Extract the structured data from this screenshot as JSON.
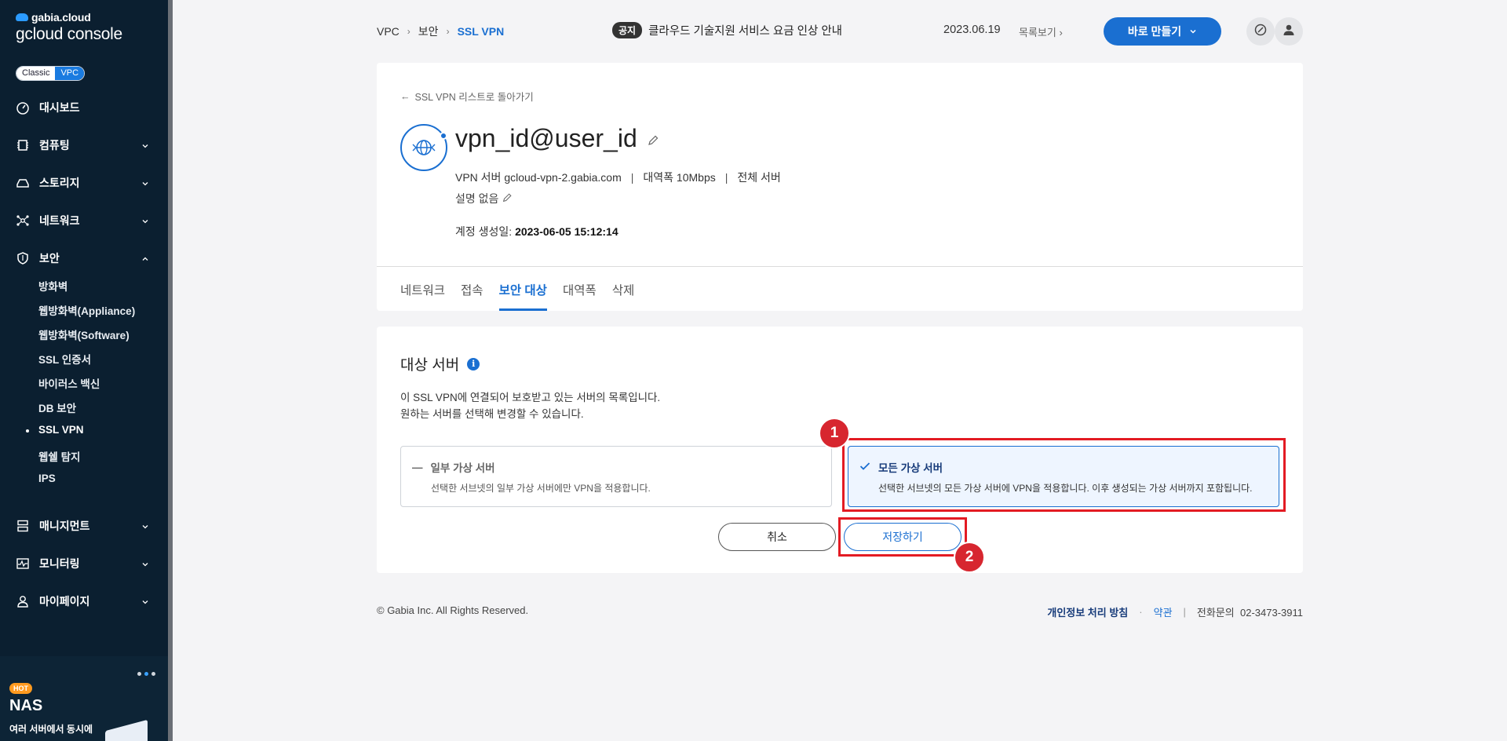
{
  "sidebar": {
    "brand_top": "gabia.cloud",
    "brand_bottom": "gcloud console",
    "mode_classic": "Classic",
    "mode_vpc": "VPC",
    "items": [
      {
        "label": "대시보드"
      },
      {
        "label": "컴퓨팅"
      },
      {
        "label": "스토리지"
      },
      {
        "label": "네트워크"
      },
      {
        "label": "보안"
      },
      {
        "label": "매니지먼트"
      },
      {
        "label": "모니터링"
      },
      {
        "label": "마이페이지"
      }
    ],
    "security_sub": [
      {
        "label": "방화벽"
      },
      {
        "label": "웹방화벽(Appliance)"
      },
      {
        "label": "웹방화벽(Software)"
      },
      {
        "label": "SSL 인증서"
      },
      {
        "label": "바이러스 백신"
      },
      {
        "label": "DB 보안"
      },
      {
        "label": "SSL VPN"
      },
      {
        "label": "웹쉘 탐지"
      },
      {
        "label": "IPS"
      }
    ],
    "promo": {
      "badge": "HOT",
      "title": "NAS",
      "desc": "여러 서버에서 동시에"
    }
  },
  "header": {
    "breadcrumb": [
      "VPC",
      "보안",
      "SSL VPN"
    ],
    "notice_badge": "공지",
    "notice_text": "클라우드 기술지원 서비스 요금 인상 안내",
    "notice_date": "2023.06.19",
    "list_link": "목록보기",
    "create_button": "바로 만들기"
  },
  "detail": {
    "back_link": "SSL VPN 리스트로 돌아가기",
    "name": "vpn_id@user_id",
    "server_label": "VPN 서버",
    "server": "gcloud-vpn-2.gabia.com",
    "bandwidth_label": "대역폭",
    "bandwidth": "10Mbps",
    "scope": "전체 서버",
    "description": "설명 없음",
    "created_label": "계정 생성일:",
    "created": "2023-06-05 15:12:14"
  },
  "tabs": [
    {
      "label": "네트워크"
    },
    {
      "label": "접속"
    },
    {
      "label": "보안 대상"
    },
    {
      "label": "대역폭"
    },
    {
      "label": "삭제"
    }
  ],
  "target": {
    "title": "대상 서버",
    "desc_line1": "이 SSL VPN에 연결되어 보호받고 있는 서버의 목록입니다.",
    "desc_line2": "원하는 서버를 선택해 변경할 수 있습니다.",
    "option_partial_title": "일부 가상 서버",
    "option_partial_desc": "선택한 서브넷의 일부 가상 서버에만 VPN을 적용합니다.",
    "option_all_title": "모든 가상 서버",
    "option_all_desc": "선택한 서브넷의 모든 가상 서버에 VPN을 적용합니다. 이후 생성되는 가상 서버까지 포함됩니다.",
    "selected": "all",
    "cancel_button": "취소",
    "save_button": "저장하기"
  },
  "annotations": [
    "1",
    "2"
  ],
  "footer": {
    "copyright": "© Gabia Inc. All Rights Reserved.",
    "privacy": "개인정보 처리 방침",
    "dot": "·",
    "terms": "약관",
    "pipe": "|",
    "phone_label": "전화문의",
    "phone": "02-3473-3911"
  },
  "colors": {
    "accent": "#1a6fd1",
    "sidebar_bg": "#0b1f30",
    "annotation": "#e31b23"
  }
}
